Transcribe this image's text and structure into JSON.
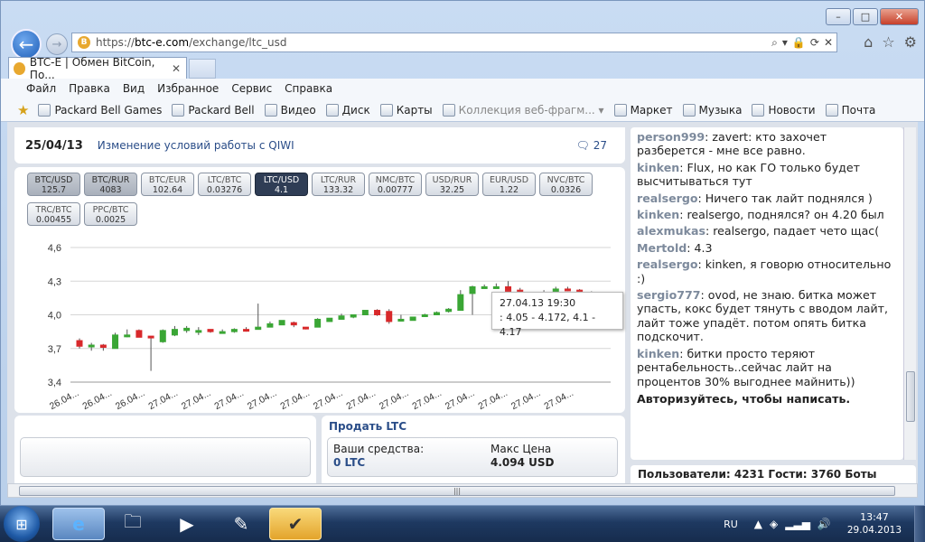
{
  "window": {
    "min": "–",
    "max": "□",
    "close": "✕"
  },
  "address": {
    "prefix": "https://",
    "domain": "btc-e.com",
    "path": "/exchange/ltc_usd",
    "icons": [
      "search-icon",
      "dropdown-icon",
      "lock-icon",
      "refresh-icon",
      "stop-icon"
    ]
  },
  "tab": {
    "title": "BTC-E | Обмен BitCoin, По...",
    "close": "✕"
  },
  "menu": [
    "Файл",
    "Правка",
    "Вид",
    "Избранное",
    "Сервис",
    "Справка"
  ],
  "favorites": [
    {
      "label": "Packard Bell Games"
    },
    {
      "label": "Packard Bell"
    },
    {
      "label": "Видео"
    },
    {
      "label": "Диск"
    },
    {
      "label": "Карты"
    },
    {
      "label": "Коллекция веб-фрагм... ▾",
      "gray": true
    },
    {
      "label": "Маркет"
    },
    {
      "label": "Музыка"
    },
    {
      "label": "Новости"
    },
    {
      "label": "Почта"
    }
  ],
  "news": {
    "date": "25/04/13",
    "title": "Изменение условий работы с QIWI",
    "comments": "27"
  },
  "pairs": [
    {
      "name": "BTC/USD",
      "value": "125.7",
      "state": "dark"
    },
    {
      "name": "BTC/RUR",
      "value": "4083",
      "state": "dark"
    },
    {
      "name": "BTC/EUR",
      "value": "102.64"
    },
    {
      "name": "LTC/BTC",
      "value": "0.03276"
    },
    {
      "name": "LTC/USD",
      "value": "4.1",
      "state": "active"
    },
    {
      "name": "LTC/RUR",
      "value": "133.32"
    },
    {
      "name": "NMC/BTC",
      "value": "0.00777"
    },
    {
      "name": "USD/RUR",
      "value": "32.25"
    },
    {
      "name": "EUR/USD",
      "value": "1.22"
    },
    {
      "name": "NVC/BTC",
      "value": "0.0326"
    },
    {
      "name": "TRC/BTC",
      "value": "0.00455"
    },
    {
      "name": "PPC/BTC",
      "value": "0.0025"
    }
  ],
  "chart_data": {
    "type": "candlestick",
    "ylim": [
      3.4,
      4.6
    ],
    "yticks": [
      "4,6",
      "4,3",
      "4,0",
      "3,7",
      "3,4"
    ],
    "xticks": [
      "26.04...",
      "26.04...",
      "26.04...",
      "27.04...",
      "27.04...",
      "27.04...",
      "27.04...",
      "27.04...",
      "27.04...",
      "27.04...",
      "27.04...",
      "27.04...",
      "27.04...",
      "27.04...",
      "27.04...",
      "27.04..."
    ],
    "up_color": "#3aa635",
    "down_color": "#d8292b",
    "candles": [
      [
        3.77,
        3.72,
        3.79,
        3.7
      ],
      [
        3.72,
        3.73,
        3.75,
        3.68
      ],
      [
        3.73,
        3.71,
        3.74,
        3.68
      ],
      [
        3.7,
        3.82,
        3.84,
        3.7
      ],
      [
        3.82,
        3.82,
        3.87,
        3.8
      ],
      [
        3.86,
        3.8,
        3.87,
        3.8
      ],
      [
        3.81,
        3.8,
        3.81,
        3.5
      ],
      [
        3.76,
        3.86,
        3.87,
        3.75
      ],
      [
        3.82,
        3.87,
        3.9,
        3.81
      ],
      [
        3.86,
        3.88,
        3.9,
        3.84
      ],
      [
        3.86,
        3.86,
        3.89,
        3.82
      ],
      [
        3.87,
        3.85,
        3.87,
        3.84
      ],
      [
        3.85,
        3.85,
        3.87,
        3.84
      ],
      [
        3.85,
        3.87,
        3.88,
        3.84
      ],
      [
        3.87,
        3.86,
        3.89,
        3.85
      ],
      [
        3.87,
        3.89,
        4.1,
        3.87
      ],
      [
        3.89,
        3.92,
        3.94,
        3.89
      ],
      [
        3.91,
        3.95,
        3.95,
        3.91
      ],
      [
        3.93,
        3.91,
        3.94,
        3.89
      ],
      [
        3.89,
        3.88,
        3.89,
        3.87
      ],
      [
        3.89,
        3.96,
        3.97,
        3.89
      ],
      [
        3.94,
        3.97,
        3.97,
        3.94
      ],
      [
        3.96,
        3.99,
        4.01,
        3.96
      ],
      [
        3.98,
        4.0,
        4.0,
        3.97
      ],
      [
        4.0,
        4.04,
        4.04,
        4.0
      ],
      [
        4.04,
        4.0,
        4.05,
        3.99
      ],
      [
        4.03,
        3.94,
        4.05,
        3.92
      ],
      [
        3.95,
        3.96,
        4.0,
        3.94
      ],
      [
        3.95,
        3.98,
        3.98,
        3.95
      ],
      [
        3.99,
        4.0,
        4.01,
        3.99
      ],
      [
        4.0,
        4.02,
        4.03,
        4.0
      ],
      [
        4.03,
        4.05,
        4.06,
        4.02
      ],
      [
        4.04,
        4.18,
        4.22,
        4.04
      ],
      [
        4.19,
        4.25,
        4.26,
        4.0
      ],
      [
        4.25,
        4.25,
        4.27,
        4.24
      ],
      [
        4.25,
        4.25,
        4.28,
        4.24
      ],
      [
        4.25,
        4.2,
        4.3,
        4.0
      ],
      [
        4.22,
        4.11,
        4.24,
        4.05
      ],
      [
        4.09,
        4.14,
        4.15,
        4.08
      ],
      [
        4.12,
        4.2,
        4.22,
        4.12
      ],
      [
        4.18,
        4.23,
        4.25,
        4.17
      ],
      [
        4.23,
        4.22,
        4.25,
        4.21
      ],
      [
        4.22,
        4.2,
        4.23,
        4.17
      ],
      [
        4.2,
        4.17,
        4.21,
        4.15
      ],
      [
        4.17,
        4.1,
        4.17,
        4.05
      ]
    ]
  },
  "tooltip": {
    "time": "27.04.13 19:30",
    "values": ": 4.05 - 4.172, 4.1 - 4.17"
  },
  "sell": {
    "title": "Продать LTC",
    "funds_label": "Ваши средства:",
    "funds_value": "0 LTC",
    "max_label": "Макс Цена",
    "max_value": "4.094 USD"
  },
  "chat": [
    {
      "user": "person999",
      "text": ": zavert: кто захочет разберется - мне все равно."
    },
    {
      "user": "kinken",
      "text": ": Flux, но как ГО только будет высчитываться тут"
    },
    {
      "user": "realsergo",
      "text": ": Ничего так лайт поднялся )"
    },
    {
      "user": "kinken",
      "text": ": realsergo, поднялся? он 4.20 был"
    },
    {
      "user": "alexmukas",
      "text": ": realsergo, падает чето щас("
    },
    {
      "user": "Mertold",
      "text": ": 4.3"
    },
    {
      "user": "realsergo",
      "text": ": kinken, я говорю относительно :)"
    },
    {
      "user": "sergio777",
      "text": ": ovod, не знаю. битка может упасть, кокс будет тянуть с вводом лайт, лайт тоже упадёт. потом опять битка подскочит."
    },
    {
      "user": "kinken",
      "text": ": битки просто теряют рентабельность..сейчас лайт на процентов 30% выгоднее майнить))"
    }
  ],
  "chat_login": "Авторизуйтесь, чтобы написать.",
  "stats": "Пользователи: 4231 Гости: 3760 Боты",
  "taskbar": {
    "lang": "RU",
    "time": "13:47",
    "date": "29.04.2013"
  }
}
